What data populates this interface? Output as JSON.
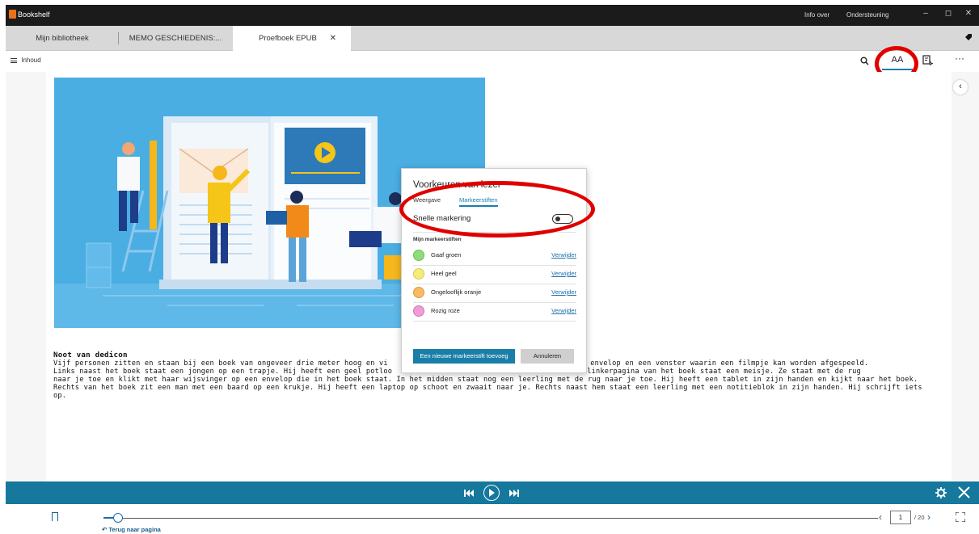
{
  "window": {
    "title": "Bookshelf",
    "links": [
      "Info over",
      "Ondersteuning"
    ],
    "controls": [
      "–",
      "◻",
      "✕"
    ]
  },
  "tabs": [
    {
      "label": "Mijn bibliotheek",
      "active": false
    },
    {
      "label": "MEMO GESCHIEDENIS:...",
      "active": false
    },
    {
      "label": "Proefboek EPUB",
      "active": true
    }
  ],
  "toolbar": {
    "toc_label": "Inhoud",
    "text_settings_label": "AA"
  },
  "note": {
    "heading": "Noot van dedicon",
    "body_left": "Vijf personen zitten en staan bij een boek van ongeveer drie meter hoog en vi",
    "body_right": "een envelop en een venster waarin een filmpje kan worden afgespeeld.",
    "line2_left": "Links naast het boek staat een jongen op een trapje. Hij heeft een geel potloo",
    "line2_right": "n. Voor de linkerpagina van het boek staat een meisje. Ze staat met de rug",
    "rest": "naar je toe en klikt met haar wijsvinger op een envelop die in het boek staat. In het midden staat nog een leerling met de rug naar je toe. Hij heeft een tablet in zijn handen en kijkt naar het boek. Rechts van het boek zit een man met een baard op een krukje. Hij heeft een laptop op schoot en zwaait naar je. Rechts naast hem staat een leerling met een notitieblok in zijn handen. Hij schrijft iets op."
  },
  "dialog": {
    "title": "Voorkeuren van lezer",
    "tabs": [
      "Weergave",
      "Markeerstiften"
    ],
    "quick_label": "Snelle markering",
    "quick_on": false,
    "section": "Mijn markeerstiften",
    "highlighters": [
      {
        "name": "Gaaf groen",
        "color": "#8fdc7b",
        "action": "Verwijder"
      },
      {
        "name": "Heel geel",
        "color": "#f6ec7d",
        "action": "Verwijder"
      },
      {
        "name": "Ongelooflijk oranje",
        "color": "#f7bb64",
        "action": "Verwijder"
      },
      {
        "name": "Rozig roze",
        "color": "#f39ad8",
        "action": "Verwijder"
      }
    ],
    "add_button": "Een nieuwe markeerstift toevoeg",
    "cancel_button": "Annuleren"
  },
  "pager": {
    "back_label": "Terug naar pagina",
    "current_page": "1",
    "total": "/ 20"
  },
  "colors": {
    "accent": "#1a7fa8",
    "annotation": "#e00000"
  }
}
